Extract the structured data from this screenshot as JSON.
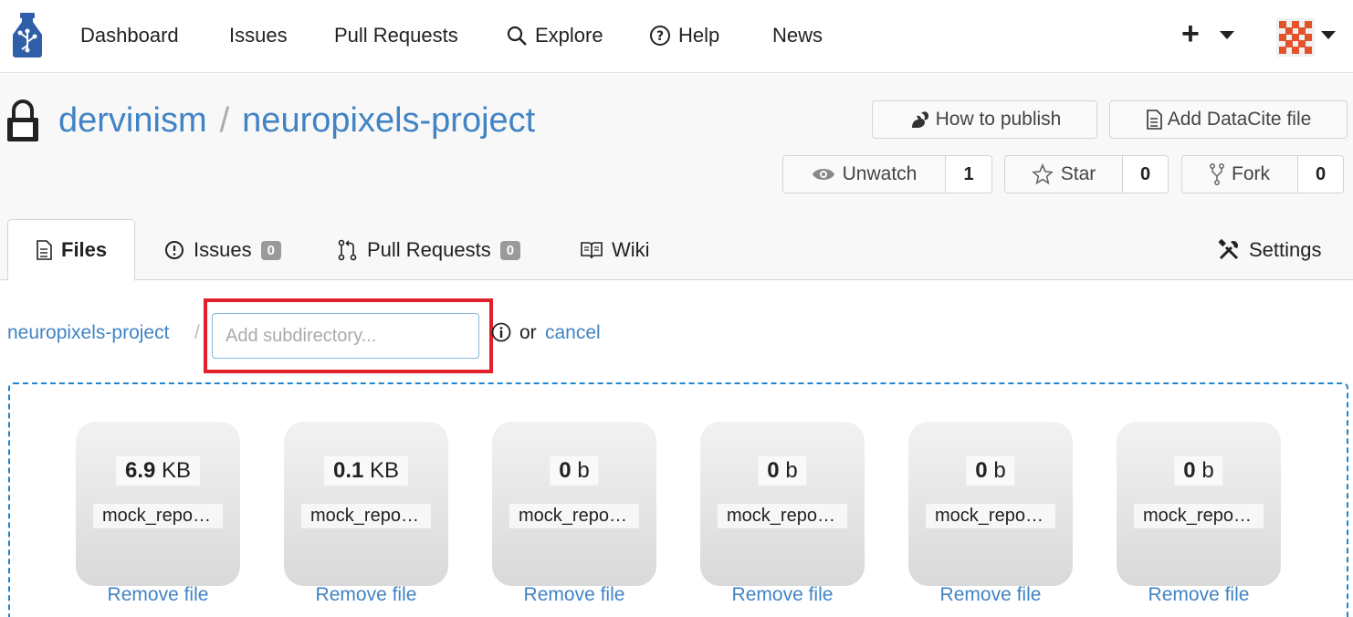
{
  "nav": {
    "items": [
      {
        "label": "Dashboard",
        "icon": ""
      },
      {
        "label": "Issues",
        "icon": ""
      },
      {
        "label": "Pull Requests",
        "icon": ""
      },
      {
        "label": "Explore",
        "icon": "search-icon"
      },
      {
        "label": "Help",
        "icon": "help-circle-icon"
      },
      {
        "label": "News",
        "icon": ""
      }
    ],
    "plus": "+"
  },
  "repo": {
    "owner": "dervinism",
    "separator": "/",
    "name": "neuropixels-project"
  },
  "header_buttons": {
    "how_to_publish": "How to publish",
    "add_datacite": "Add DataCite file"
  },
  "stats": {
    "watch": {
      "label": "Unwatch",
      "count": "1"
    },
    "star": {
      "label": "Star",
      "count": "0"
    },
    "fork": {
      "label": "Fork",
      "count": "0"
    }
  },
  "tabs": {
    "files": "Files",
    "issues": {
      "label": "Issues",
      "count": "0"
    },
    "pulls": {
      "label": "Pull Requests",
      "count": "0"
    },
    "wiki": "Wiki",
    "settings": "Settings"
  },
  "path": {
    "root": "neuropixels-project",
    "separator": "/",
    "subdir_placeholder": "Add subdirectory...",
    "or": "or",
    "cancel": "cancel"
  },
  "files": [
    {
      "size_num": "6.9",
      "size_unit": "KB",
      "name": "mock_repos...",
      "remove": "Remove file"
    },
    {
      "size_num": "0.1",
      "size_unit": "KB",
      "name": "mock_repos...",
      "remove": "Remove file"
    },
    {
      "size_num": "0",
      "size_unit": "b",
      "name": "mock_repos...",
      "remove": "Remove file"
    },
    {
      "size_num": "0",
      "size_unit": "b",
      "name": "mock_repos...",
      "remove": "Remove file"
    },
    {
      "size_num": "0",
      "size_unit": "b",
      "name": "mock_repos...",
      "remove": "Remove file"
    },
    {
      "size_num": "0",
      "size_unit": "b",
      "name": "mock_repos...",
      "remove": "Remove file"
    }
  ],
  "colors": {
    "link": "#4183c4",
    "highlight": "#e0202b",
    "dropzone": "#2185d0"
  }
}
